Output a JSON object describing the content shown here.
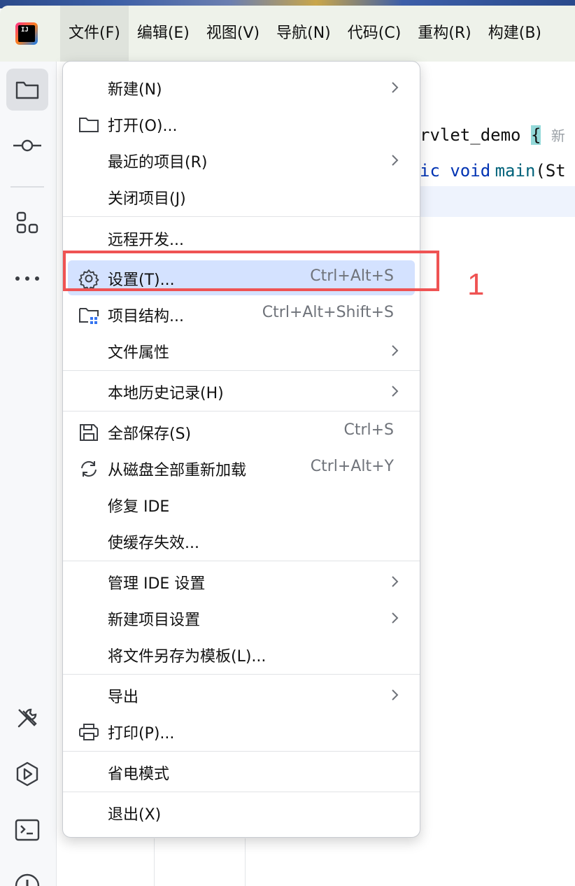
{
  "menubar": {
    "items": [
      "文件(F)",
      "编辑(E)",
      "视图(V)",
      "导航(N)",
      "代码(C)",
      "重构(R)",
      "构建(B)"
    ]
  },
  "app_logo_text": "IJ",
  "editor": {
    "line1": "rvlet_demo",
    "line1_brace": "{",
    "line1_hint": "新",
    "line2_keyword": "ic void",
    "line2_method": "main",
    "line2_rest": "(St"
  },
  "file_menu": {
    "items": [
      {
        "label": "新建(N)",
        "shortcut": "",
        "submenu": true,
        "icon": "none"
      },
      {
        "label": "打开(O)...",
        "shortcut": "",
        "submenu": false,
        "icon": "folder-icon"
      },
      {
        "label": "最近的项目(R)",
        "shortcut": "",
        "submenu": true,
        "icon": "none"
      },
      {
        "label": "关闭项目(J)",
        "shortcut": "",
        "submenu": false,
        "icon": "none"
      },
      {
        "label": "远程开发...",
        "shortcut": "",
        "submenu": false,
        "icon": "none"
      },
      {
        "label": "设置(T)...",
        "shortcut": "Ctrl+Alt+S",
        "submenu": false,
        "icon": "gear-icon"
      },
      {
        "label": "项目结构...",
        "shortcut": "Ctrl+Alt+Shift+S",
        "submenu": false,
        "icon": "project-structure-icon"
      },
      {
        "label": "文件属性",
        "shortcut": "",
        "submenu": true,
        "icon": "none"
      },
      {
        "label": "本地历史记录(H)",
        "shortcut": "",
        "submenu": true,
        "icon": "none"
      },
      {
        "label": "全部保存(S)",
        "shortcut": "Ctrl+S",
        "submenu": false,
        "icon": "save-icon"
      },
      {
        "label": "从磁盘全部重新加载",
        "shortcut": "Ctrl+Alt+Y",
        "submenu": false,
        "icon": "reload-icon"
      },
      {
        "label": "修复 IDE",
        "shortcut": "",
        "submenu": false,
        "icon": "none"
      },
      {
        "label": "使缓存失效...",
        "shortcut": "",
        "submenu": false,
        "icon": "none"
      },
      {
        "label": "管理 IDE 设置",
        "shortcut": "",
        "submenu": true,
        "icon": "none"
      },
      {
        "label": "新建项目设置",
        "shortcut": "",
        "submenu": true,
        "icon": "none"
      },
      {
        "label": "将文件另存为模板(L)...",
        "shortcut": "",
        "submenu": false,
        "icon": "none"
      },
      {
        "label": "导出",
        "shortcut": "",
        "submenu": true,
        "icon": "none"
      },
      {
        "label": "打印(P)...",
        "shortcut": "",
        "submenu": false,
        "icon": "print-icon"
      },
      {
        "label": "省电模式",
        "shortcut": "",
        "submenu": false,
        "icon": "none"
      },
      {
        "label": "退出(X)",
        "shortcut": "",
        "submenu": false,
        "icon": "none"
      }
    ]
  },
  "annotation": {
    "number": "1",
    "color": "#ef5353"
  },
  "colors": {
    "highlight": "#d4e2ff",
    "menubar_bg": "#eef2ea",
    "accent": "#3574f0"
  }
}
